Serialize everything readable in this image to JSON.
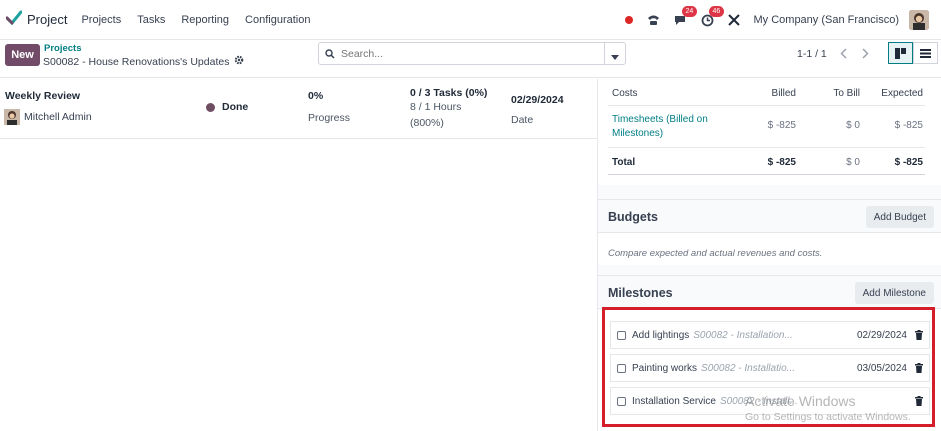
{
  "app": {
    "name": "Project"
  },
  "menu": [
    "Projects",
    "Tasks",
    "Reporting",
    "Configuration"
  ],
  "systray": {
    "chat_count": "24",
    "activity_count": "46",
    "company": "My Company (San Francisco)"
  },
  "control": {
    "new_label": "New",
    "breadcrumb_parent": "Projects",
    "breadcrumb_current": "S00082 - House Renovations's Updates",
    "search_placeholder": "Search...",
    "pager": "1-1 / 1"
  },
  "update": {
    "title": "Weekly Review",
    "user": "Mitchell Admin",
    "status": "Done",
    "status_color": "#6f4e64",
    "progress_value": "0%",
    "progress_label": "Progress",
    "tasks": "0 / 3 Tasks (0%)",
    "hours": "8 / 1 Hours",
    "hours_pct": "(800%)",
    "date_value": "02/29/2024",
    "date_label": "Date"
  },
  "costs": {
    "headers": [
      "Costs",
      "Billed",
      "To Bill",
      "Expected"
    ],
    "row": {
      "name": "Timesheets (Billed on Milestones)",
      "billed": "$ -825",
      "to_bill": "$ 0",
      "expected": "$ -825"
    },
    "total": {
      "name": "Total",
      "billed": "$ -825",
      "to_bill": "$ 0",
      "expected": "$ -825"
    }
  },
  "budgets": {
    "title": "Budgets",
    "add_label": "Add Budget",
    "description": "Compare expected and actual revenues and costs."
  },
  "milestones": {
    "title": "Milestones",
    "add_label": "Add Milestone",
    "items": [
      {
        "name": "Add lightings",
        "ref": "S00082 - Installation...",
        "date": "02/29/2024"
      },
      {
        "name": "Painting works",
        "ref": "S00082 - Installatio...",
        "date": "03/05/2024"
      },
      {
        "name": "Installation Service",
        "ref": "S00082 - Install...",
        "date": ""
      }
    ]
  },
  "watermark": {
    "title": "Activate Windows",
    "subtitle": "Go to Settings to activate Windows."
  },
  "colors": {
    "brand": "#714b67",
    "accent": "#017e84",
    "highlight": "#d41e2a"
  }
}
